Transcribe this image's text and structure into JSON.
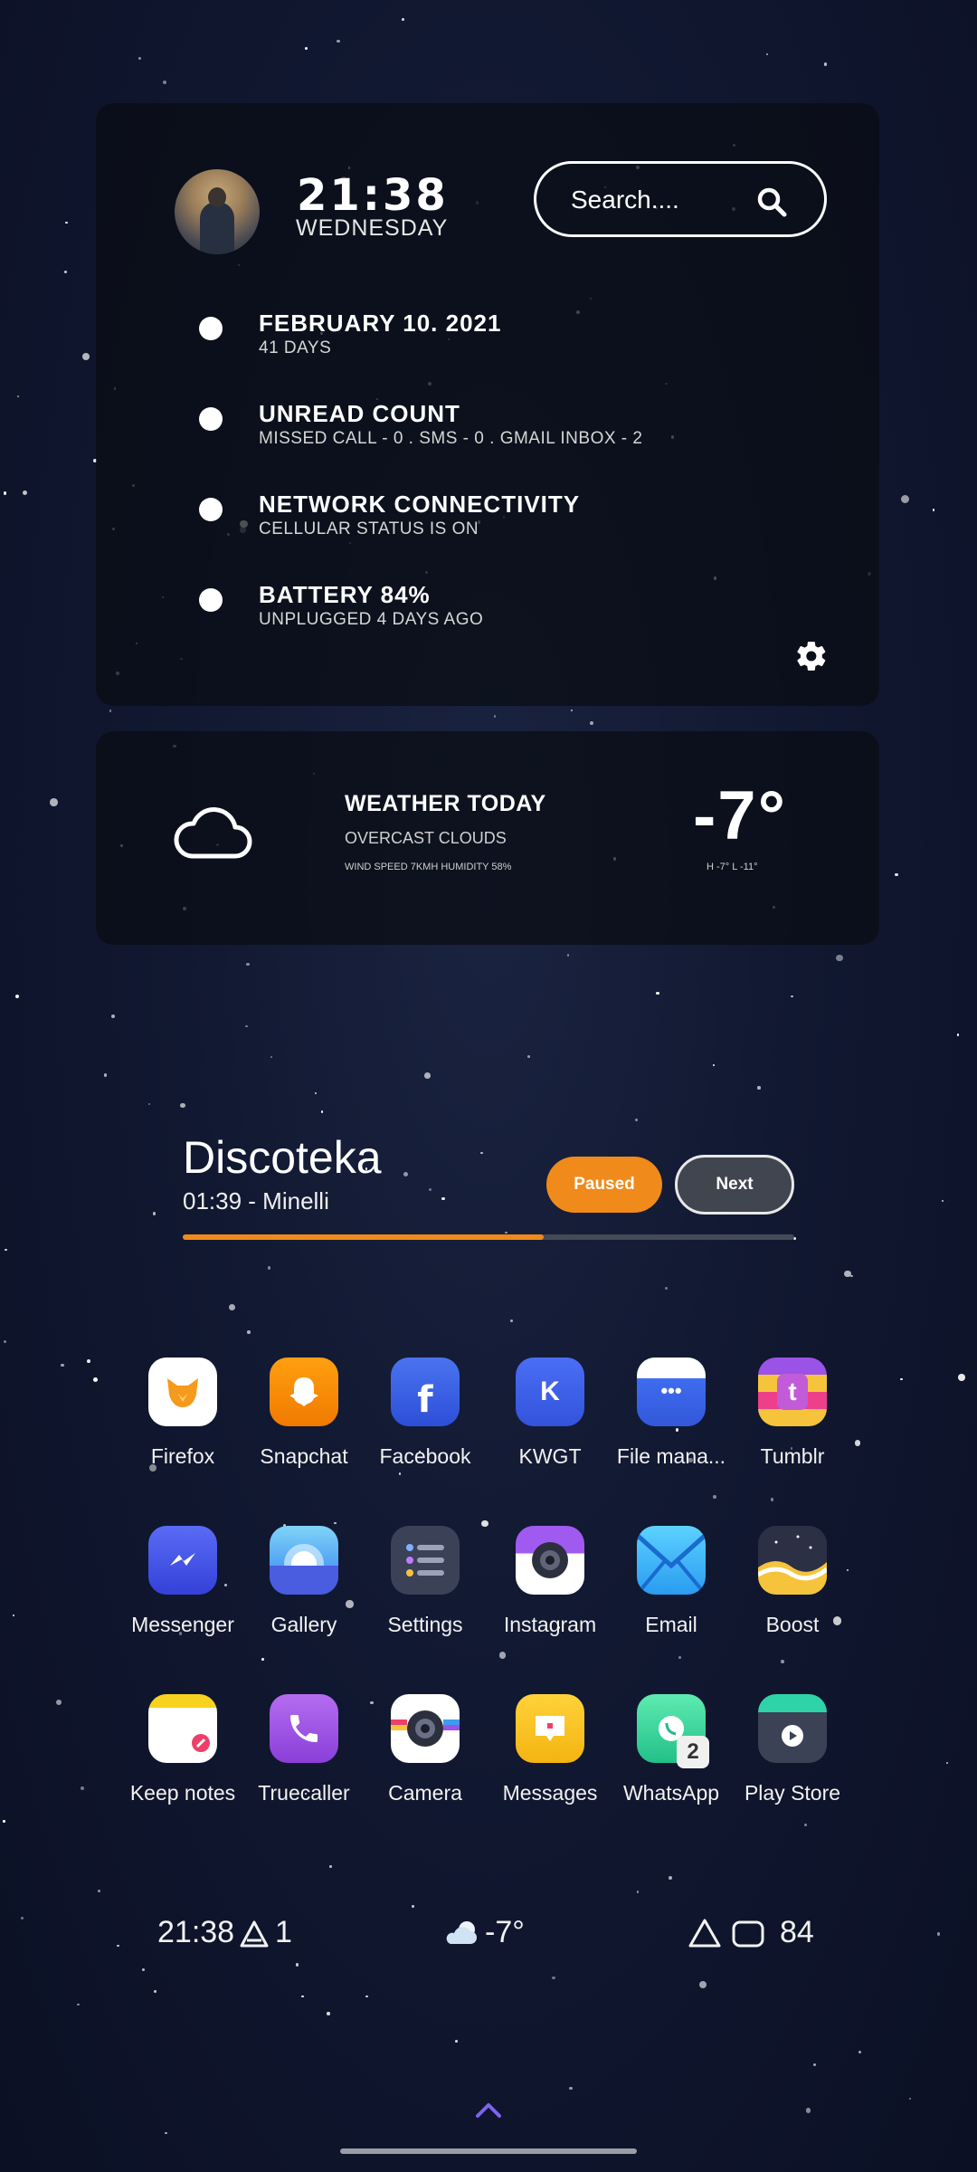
{
  "clock": {
    "time": "21:38",
    "day": "WEDNESDAY"
  },
  "search": {
    "label": "Search...."
  },
  "info_items": [
    {
      "title": "FEBRUARY 10. 2021",
      "sub": "41 DAYS"
    },
    {
      "title": "UNREAD COUNT",
      "sub": "MISSED CALL - 0  .  SMS - 0  .  GMAIL INBOX - 2"
    },
    {
      "title": "NETWORK CONNECTIVITY",
      "sub": "CELLULAR STATUS IS ON"
    },
    {
      "title": "BATTERY 84%",
      "sub": "UNPLUGGED 4 DAYS AGO"
    }
  ],
  "weather": {
    "title": "WEATHER TODAY",
    "desc": "OVERCAST CLOUDS",
    "meta": "WIND SPEED 7KMH  HUMIDITY 58%",
    "temp": "-7°",
    "hl": "H -7°  L -11°"
  },
  "music": {
    "title": "Discoteka",
    "sub": "01:39 - Minelli",
    "paused_label": "Paused",
    "next_label": "Next",
    "progress": 0.59
  },
  "apps": [
    {
      "label": "Firefox",
      "icon": "firefox-icon"
    },
    {
      "label": "Snapchat",
      "icon": "snapchat-icon"
    },
    {
      "label": "Facebook",
      "icon": "facebook-icon"
    },
    {
      "label": "KWGT",
      "icon": "kwgt-icon"
    },
    {
      "label": "File mana...",
      "icon": "file-manager-icon"
    },
    {
      "label": "Tumblr",
      "icon": "tumblr-icon"
    },
    {
      "label": "Messenger",
      "icon": "messenger-icon"
    },
    {
      "label": "Gallery",
      "icon": "gallery-icon"
    },
    {
      "label": "Settings",
      "icon": "settings-app-icon"
    },
    {
      "label": "Instagram",
      "icon": "instagram-icon"
    },
    {
      "label": "Email",
      "icon": "email-icon"
    },
    {
      "label": "Boost",
      "icon": "boost-icon"
    },
    {
      "label": "Keep notes",
      "icon": "keep-notes-icon"
    },
    {
      "label": "Truecaller",
      "icon": "truecaller-icon"
    },
    {
      "label": "Camera",
      "icon": "camera-icon"
    },
    {
      "label": "Messages",
      "icon": "messages-icon"
    },
    {
      "label": "WhatsApp",
      "icon": "whatsapp-icon",
      "badge": "2"
    },
    {
      "label": "Play Store",
      "icon": "play-store-icon"
    }
  ],
  "status_row": {
    "time": "21:38",
    "notifications": "1",
    "temp": "-7°",
    "battery": "84"
  },
  "colors": {
    "accent": "#f08a1a",
    "card": "#0a0c14"
  }
}
